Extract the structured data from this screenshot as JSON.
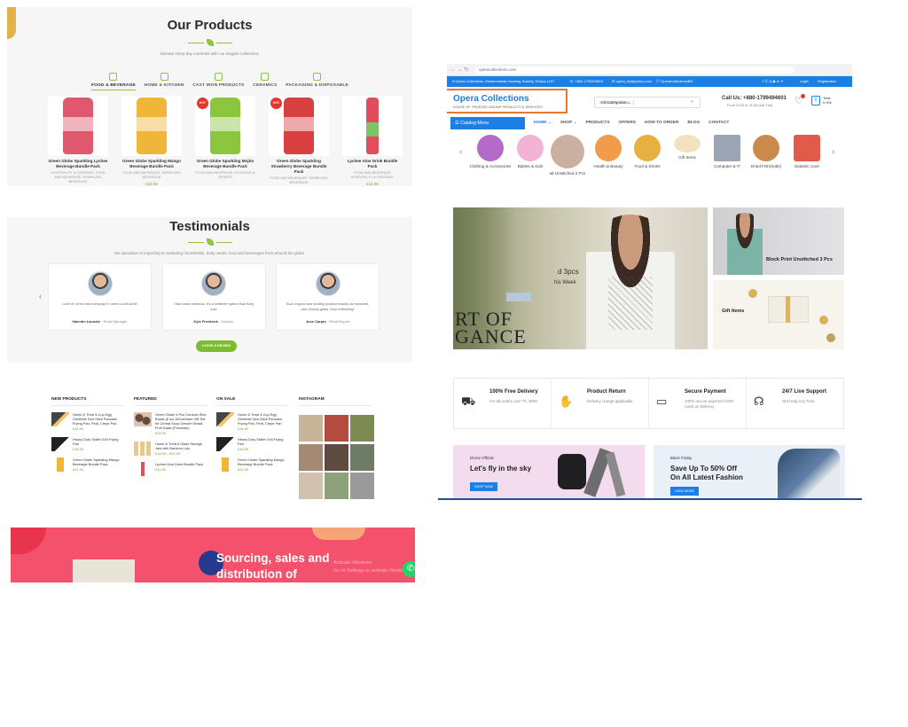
{
  "products_section": {
    "title": "Our Products",
    "subtitle": "Elevate every day moments with our elegant collections",
    "tabs": [
      {
        "label": "FOOD & BEVERAGE",
        "active": true
      },
      {
        "label": "HOME & KITCHEN"
      },
      {
        "label": "CAST IRON PRODUCTS"
      },
      {
        "label": "CERAMICS"
      },
      {
        "label": "PACKAGING & DISPOSABLE"
      }
    ],
    "items": [
      {
        "name": "Green Globe Sparkling Lychee Beverage Bundle Pack",
        "category": "HOSPITALITY & CATERING, FOOD AND BEVERAGE, SPARKLING BEVERAGE",
        "price": "",
        "badge": "",
        "color": "#e0586e"
      },
      {
        "name": "Green Globe Sparkling Mango Beverage Bundle Pack",
        "category": "FOOD AND BEVERAGE, SPARKLING BEVERAGE",
        "price": "£22.00",
        "badge": "",
        "color": "#f0b63a"
      },
      {
        "name": "Green Globe Sparkling Mojito Beverage Bundle Pack",
        "category": "FOOD AND BEVERAGE, OUTDOOR & SPORTS",
        "price": "",
        "badge": "HOT",
        "color": "#8cc63f"
      },
      {
        "name": "Green Globe Sparkling Strawberry Beverage Bundle Pack",
        "category": "FOOD AND BEVERAGE, SPARKLING BEVERAGE",
        "price": "",
        "badge": "HOT",
        "color": "#d94040"
      },
      {
        "name": "Lychee Aloe Drink Bundle Pack",
        "category": "FOOD AND BEVERAGE, HOSPITALITY & CATERING",
        "price": "£12.00",
        "badge": "",
        "color": "#e24d5b"
      }
    ]
  },
  "testimonials": {
    "title": "Testimonials",
    "subtitle": "We specialize in importing & marketing households, daily needs, food and beverages from around the globe.",
    "cards": [
      {
        "quote": "Love it! I drink this everyday if I need a soft drink!",
        "name": "Valentin Lacoste",
        "role": " · Retail Manager"
      },
      {
        "quote": "I like rustic delicious. It's a healthier option than fizzy cola",
        "name": "Kyle Frederick",
        "role": " · Director"
      },
      {
        "quote": "Such a good and healthy product exactly as expected, nice chunky glass. Very refreshing!",
        "name": "Jose Carpio",
        "role": " · Retail Expert"
      }
    ],
    "button": "LEAVE A REVIEW",
    "prev": "‹",
    "next": "›"
  },
  "lists": {
    "new_products": {
      "heading": "NEW PRODUCTS",
      "items": [
        {
          "name": "Home & Treat 4-Cup Egg Omelette Non-Stick Pancake Frying Pan, Pedi, Crepe Pan",
          "price": "£15.99"
        },
        {
          "name": "Heavy Duty Skillet Grill Frying Pan",
          "price": "£18.99"
        },
        {
          "name": "Green Globe Sparkling Mango Beverage Bundle Pack",
          "price": "£22.00"
        }
      ]
    },
    "featured": {
      "heading": "FEATURED",
      "items": [
        {
          "name": "Green Globe 6 Pcs Ceramic Rice Bowls (6 oz) Dinnerware Gift Set for Cereal Soup Dessert Snack Fruit Salsa (Porcelain)",
          "price": "£15.99"
        },
        {
          "name": "Home & Treat 6 Glass Storage Jars with Bamboo Lids",
          "price": "£14.99 – £21.99"
        },
        {
          "name": "Lychee Aloe Drink Bundle Pack",
          "price": "£12.00"
        }
      ]
    },
    "on_sale": {
      "heading": "ON SALE",
      "items": [
        {
          "name": "Home & Treat 4-Cup Egg Omelette Non-Stick Pancake Frying Pan, Pedi, Crepe Pan",
          "price": "£15.99"
        },
        {
          "name": "Heavy Duty Skillet Grill Frying Pan",
          "price": "£18.99"
        },
        {
          "name": "Green Globe Sparkling Mango Beverage Bundle Pack",
          "price": "£22.00"
        }
      ]
    },
    "instagram": {
      "heading": "INSTAGRAM"
    }
  },
  "banner": {
    "line1": "Sourcing, sales and",
    "line2": "distribution of",
    "faint1": "Activate Windows",
    "faint2": "Go to Settings to activate Windows"
  },
  "opera": {
    "url": "operacollections.com",
    "topbar": {
      "address": "Opera Collections, Mohammadia Housing Society, Dhaka-1207",
      "phone": "+880-1799494601",
      "email": "opera_bd@yahoo.com",
      "facebook": "OperaCollectionsBD",
      "login": "Login",
      "register": "Registration"
    },
    "logo": {
      "name": "Opera Collections",
      "tagline": "HOUSE OF TRUSTED ONLINE PRODUCTS & SERVICES"
    },
    "search": {
      "category": "All Categories",
      "placeholder": "Search Products..."
    },
    "call": {
      "title": "Call Us: +880-1799494601",
      "hours": "From 10:00 to 21:00 (Sat-Thu)"
    },
    "cart": {
      "count": "0",
      "total_label": "Total",
      "total": "0.00৳"
    },
    "catalog_label": "Catalog Menu",
    "nav": [
      "HOME ⌄",
      "SHOP ⌄",
      "PRODUCTS",
      "OFFERS",
      "HOW TO ORDER",
      "BLOG",
      "CONTACT"
    ],
    "categories": [
      {
        "label": "Clothing & Accessories",
        "color": "#b569c8"
      },
      {
        "label": "Babies & Kids",
        "color": "#f3b3d4"
      },
      {
        "label": "all Unstitched 3 Pcs",
        "color": "#c9b0a1"
      },
      {
        "label": "Health & Beauty",
        "color": "#f09c4a"
      },
      {
        "label": "Food & Drinks",
        "color": "#e8b040"
      },
      {
        "label": "Gift Items",
        "color": "#f2e3c0"
      },
      {
        "label": "Computer & IT",
        "color": "#9aa6b3"
      },
      {
        "label": "Dried Fish(Sutki)",
        "color": "#c98a4b"
      },
      {
        "label": "Diabetic Care",
        "color": "#e25b4a"
      }
    ],
    "hero": {
      "big": "RT OF\nGANCE",
      "mid": "d 3pcs",
      "mid2": "his Week"
    },
    "side1_label": "Block Print Unstitched 3 Pcs",
    "side2_label": "Gift Items",
    "features": [
      {
        "title": "100% Free Delivery",
        "desc": "For all orders over Tk. 3000",
        "icon": "truck-icon",
        "glyph": "⛟"
      },
      {
        "title": "Product Return",
        "desc": "Delivery charge applicable",
        "icon": "hand-icon",
        "glyph": "✋"
      },
      {
        "title": "Secure Payment",
        "desc": "100% secure payment COD- Cash on Delivery",
        "icon": "card-icon",
        "glyph": "▭"
      },
      {
        "title": "24/7 Live Support",
        "desc": "Get Help Any Time",
        "icon": "headset-icon",
        "glyph": "☊"
      }
    ],
    "promo1": {
      "small": "Drone Official",
      "title": "Let's fly in the sky",
      "button": "SHOP NOW"
    },
    "promo2": {
      "small": "Black Friday",
      "title": "Save Up To 50% Off\nOn All Latest Fashion",
      "button": "VIEW MORE"
    }
  }
}
